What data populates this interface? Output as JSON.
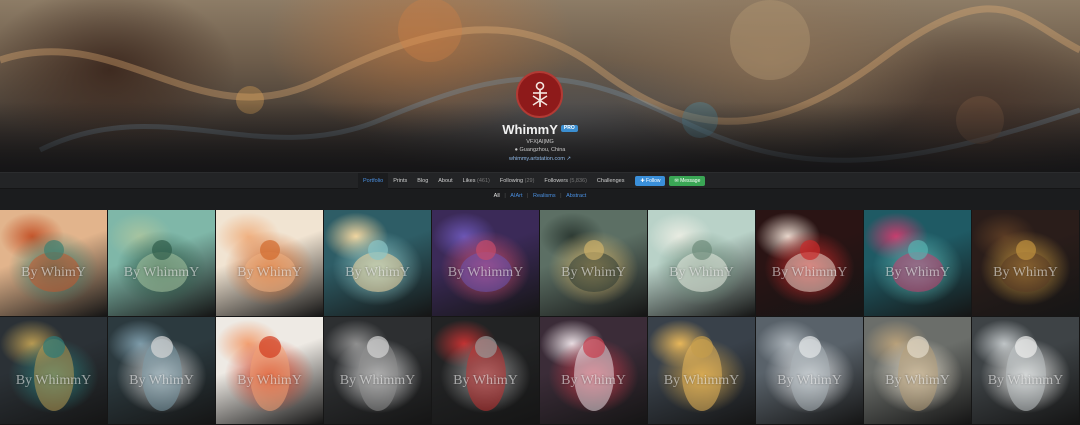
{
  "profile": {
    "name": "WhimmY",
    "badge": "PRO",
    "role": "VFX|AI|MG",
    "location": "Guangzhou, China",
    "website": "whimmy.artstation.com",
    "avatar_icon": "rune-logo-icon",
    "avatar_color": "#8e1a1a"
  },
  "nav": {
    "items": [
      {
        "label": "Portfolio",
        "count": ""
      },
      {
        "label": "Prints",
        "count": ""
      },
      {
        "label": "Blog",
        "count": ""
      },
      {
        "label": "About",
        "count": ""
      },
      {
        "label": "Likes",
        "count": "(461)"
      },
      {
        "label": "Following",
        "count": "(29)"
      },
      {
        "label": "Followers",
        "count": "(5,836)"
      },
      {
        "label": "Challenges",
        "count": ""
      }
    ],
    "follow_label": "✚ Follow",
    "message_label": "✉ Message",
    "accent": "#4a90e2"
  },
  "filters": [
    "All",
    "AIArt",
    "Realisms",
    "Abstract"
  ],
  "gallery": {
    "watermark": "By WhimY",
    "watermark_alt": "By WhimmY",
    "tiles": [
      {
        "palette": [
          "#e2b48c",
          "#3f7f6f",
          "#c4552b"
        ]
      },
      {
        "palette": [
          "#7fb7a8",
          "#2f5c4a",
          "#a7c4a0"
        ]
      },
      {
        "palette": [
          "#f1e4d2",
          "#d16a2c",
          "#f0b283"
        ]
      },
      {
        "palette": [
          "#2e5d66",
          "#8ac4c6",
          "#f2d6a0"
        ]
      },
      {
        "palette": [
          "#3b2a58",
          "#c64b6b",
          "#6b56b5"
        ]
      },
      {
        "palette": [
          "#5c6f64",
          "#cdb06a",
          "#2d3a33"
        ]
      },
      {
        "palette": [
          "#b9d2c8",
          "#6d8c7b",
          "#e9ece2"
        ]
      },
      {
        "palette": [
          "#2a1414",
          "#c82a2a",
          "#e8d7cc"
        ]
      },
      {
        "palette": [
          "#1f5a64",
          "#58b2b0",
          "#c83d6e"
        ]
      },
      {
        "palette": [
          "#2a1d1a",
          "#c2933e",
          "#5a3b24"
        ]
      },
      {
        "palette": [
          "#2b3136",
          "#2c7a78",
          "#b89a52"
        ]
      },
      {
        "palette": [
          "#2c3a3f",
          "#d8d8d8",
          "#7c9aa8"
        ]
      },
      {
        "palette": [
          "#eeeae4",
          "#d13a1e",
          "#f2a072"
        ]
      },
      {
        "palette": [
          "#2d2f31",
          "#d6d6d6",
          "#8e8e8e"
        ]
      },
      {
        "palette": [
          "#222324",
          "#9a9a9a",
          "#c23232"
        ]
      },
      {
        "palette": [
          "#3b2c38",
          "#c73c4c",
          "#e8dde2"
        ]
      },
      {
        "palette": [
          "#39414a",
          "#c59c4c",
          "#e8b75a"
        ]
      },
      {
        "palette": [
          "#59626a",
          "#e6e8ea",
          "#aab2b8"
        ]
      },
      {
        "palette": [
          "#6b6e6a",
          "#e4dccb",
          "#b8a07a"
        ]
      },
      {
        "palette": [
          "#3e4346",
          "#f0f0ee",
          "#bfc4c6"
        ]
      }
    ]
  }
}
